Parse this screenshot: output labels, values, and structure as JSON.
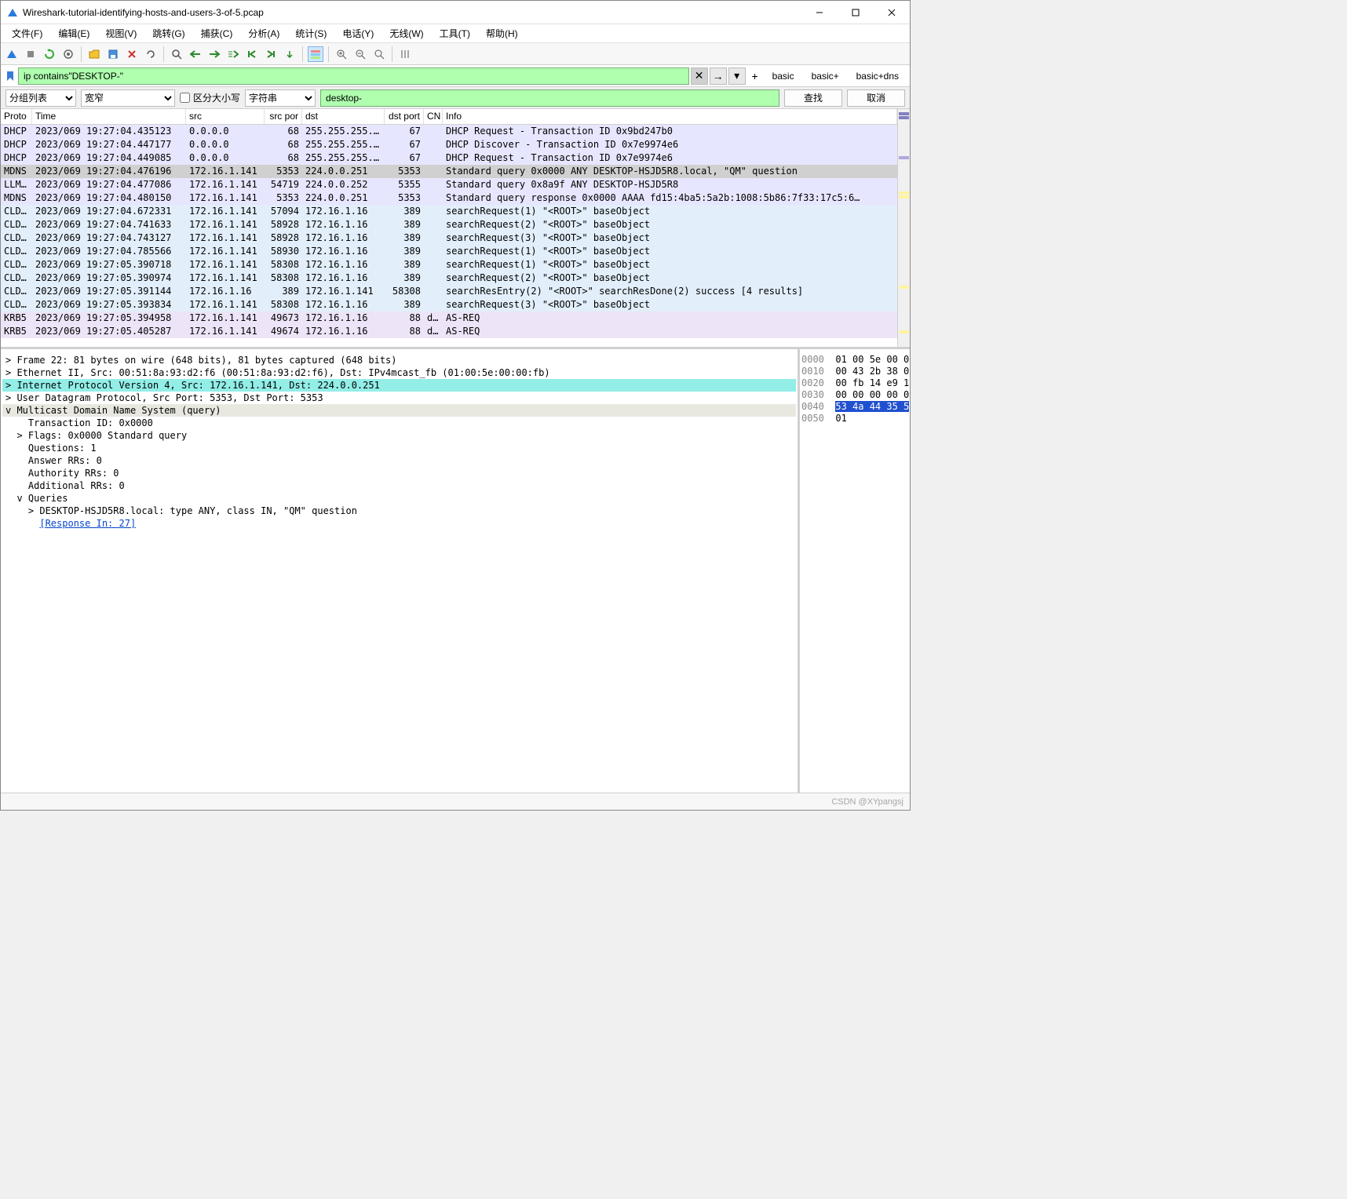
{
  "title": "Wireshark-tutorial-identifying-hosts-and-users-3-of-5.pcap",
  "menu": [
    "文件(F)",
    "编辑(E)",
    "视图(V)",
    "跳转(G)",
    "捕获(C)",
    "分析(A)",
    "统计(S)",
    "电话(Y)",
    "无线(W)",
    "工具(T)",
    "帮助(H)"
  ],
  "filter_presets": [
    "basic",
    "basic+",
    "basic+dns"
  ],
  "display_filter": "ip contains\"DESKTOP-\"",
  "search": {
    "list_mode": "分组列表",
    "width_mode": "宽窄",
    "case_label": "区分大小写",
    "type": "字符串",
    "value": "desktop-",
    "find": "查找",
    "cancel": "取消"
  },
  "columns": [
    "Proto",
    "Time",
    "src",
    "src por",
    "dst",
    "dst port",
    "CN",
    "Info"
  ],
  "rows": [
    {
      "cls": "bg-dhcp",
      "p": "DHCP",
      "t": "2023/069 19:27:04.435123",
      "s": "0.0.0.0",
      "sp": "68",
      "d": "255.255.255.…",
      "dp": "67",
      "cn": "",
      "i": "DHCP Request  - Transaction ID 0x9bd247b0"
    },
    {
      "cls": "bg-dhcp",
      "p": "DHCP",
      "t": "2023/069 19:27:04.447177",
      "s": "0.0.0.0",
      "sp": "68",
      "d": "255.255.255.…",
      "dp": "67",
      "cn": "",
      "i": "DHCP Discover - Transaction ID 0x7e9974e6"
    },
    {
      "cls": "bg-dhcp",
      "p": "DHCP",
      "t": "2023/069 19:27:04.449085",
      "s": "0.0.0.0",
      "sp": "68",
      "d": "255.255.255.…",
      "dp": "67",
      "cn": "",
      "i": "DHCP Request  - Transaction ID 0x7e9974e6"
    },
    {
      "cls": "bg-mdns-sel",
      "p": "MDNS",
      "t": "2023/069 19:27:04.476196",
      "s": "172.16.1.141",
      "sp": "5353",
      "d": "224.0.0.251",
      "dp": "5353",
      "cn": "",
      "i": "Standard query 0x0000 ANY DESKTOP-HSJD5R8.local, \"QM\" question"
    },
    {
      "cls": "bg-llm",
      "p": "LLM…",
      "t": "2023/069 19:27:04.477086",
      "s": "172.16.1.141",
      "sp": "54719",
      "d": "224.0.0.252",
      "dp": "5355",
      "cn": "",
      "i": "Standard query 0x8a9f ANY DESKTOP-HSJD5R8"
    },
    {
      "cls": "bg-mdns",
      "p": "MDNS",
      "t": "2023/069 19:27:04.480150",
      "s": "172.16.1.141",
      "sp": "5353",
      "d": "224.0.0.251",
      "dp": "5353",
      "cn": "",
      "i": "Standard query response 0x0000 AAAA fd15:4ba5:5a2b:1008:5b86:7f33:17c5:6…"
    },
    {
      "cls": "bg-cld",
      "p": "CLD…",
      "t": "2023/069 19:27:04.672331",
      "s": "172.16.1.141",
      "sp": "57094",
      "d": "172.16.1.16",
      "dp": "389",
      "cn": "",
      "i": "searchRequest(1) \"<ROOT>\" baseObject"
    },
    {
      "cls": "bg-cld",
      "p": "CLD…",
      "t": "2023/069 19:27:04.741633",
      "s": "172.16.1.141",
      "sp": "58928",
      "d": "172.16.1.16",
      "dp": "389",
      "cn": "",
      "i": "searchRequest(2) \"<ROOT>\" baseObject"
    },
    {
      "cls": "bg-cld",
      "p": "CLD…",
      "t": "2023/069 19:27:04.743127",
      "s": "172.16.1.141",
      "sp": "58928",
      "d": "172.16.1.16",
      "dp": "389",
      "cn": "",
      "i": "searchRequest(3) \"<ROOT>\" baseObject"
    },
    {
      "cls": "bg-cld",
      "p": "CLD…",
      "t": "2023/069 19:27:04.785566",
      "s": "172.16.1.141",
      "sp": "58930",
      "d": "172.16.1.16",
      "dp": "389",
      "cn": "",
      "i": "searchRequest(1) \"<ROOT>\" baseObject"
    },
    {
      "cls": "bg-cld",
      "p": "CLD…",
      "t": "2023/069 19:27:05.390718",
      "s": "172.16.1.141",
      "sp": "58308",
      "d": "172.16.1.16",
      "dp": "389",
      "cn": "",
      "i": "searchRequest(1) \"<ROOT>\" baseObject"
    },
    {
      "cls": "bg-cld",
      "p": "CLD…",
      "t": "2023/069 19:27:05.390974",
      "s": "172.16.1.141",
      "sp": "58308",
      "d": "172.16.1.16",
      "dp": "389",
      "cn": "",
      "i": "searchRequest(2) \"<ROOT>\" baseObject"
    },
    {
      "cls": "bg-cld",
      "p": "CLD…",
      "t": "2023/069 19:27:05.391144",
      "s": "172.16.1.16",
      "sp": "389",
      "d": "172.16.1.141",
      "dp": "58308",
      "cn": "",
      "i": "searchResEntry(2) \"<ROOT>\" searchResDone(2) success  [4 results]"
    },
    {
      "cls": "bg-cld",
      "p": "CLD…",
      "t": "2023/069 19:27:05.393834",
      "s": "172.16.1.141",
      "sp": "58308",
      "d": "172.16.1.16",
      "dp": "389",
      "cn": "",
      "i": "searchRequest(3) \"<ROOT>\" baseObject"
    },
    {
      "cls": "bg-krb",
      "p": "KRB5",
      "t": "2023/069 19:27:05.394958",
      "s": "172.16.1.141",
      "sp": "49673",
      "d": "172.16.1.16",
      "dp": "88",
      "cn": "d…",
      "i": "AS-REQ"
    },
    {
      "cls": "bg-krb",
      "p": "KRB5",
      "t": "2023/069 19:27:05.405287",
      "s": "172.16.1.141",
      "sp": "49674",
      "d": "172.16.1.16",
      "dp": "88",
      "cn": "d…",
      "i": "AS-REQ"
    }
  ],
  "details": [
    {
      "ind": 0,
      "exp": ">",
      "txt": "Frame 22: 81 bytes on wire (648 bits), 81 bytes captured (648 bits)"
    },
    {
      "ind": 0,
      "exp": ">",
      "txt": "Ethernet II, Src: 00:51:8a:93:d2:f6 (00:51:8a:93:d2:f6), Dst: IPv4mcast_fb (01:00:5e:00:00:fb)"
    },
    {
      "ind": 0,
      "exp": ">",
      "txt": "Internet Protocol Version 4, Src: 172.16.1.141, Dst: 224.0.0.251",
      "hl": true
    },
    {
      "ind": 0,
      "exp": ">",
      "txt": "User Datagram Protocol, Src Port: 5353, Dst Port: 5353"
    },
    {
      "ind": 0,
      "exp": "v",
      "txt": "Multicast Domain Name System (query)",
      "hl2": true
    },
    {
      "ind": 1,
      "exp": " ",
      "txt": "Transaction ID: 0x0000"
    },
    {
      "ind": 1,
      "exp": ">",
      "txt": "Flags: 0x0000 Standard query"
    },
    {
      "ind": 1,
      "exp": " ",
      "txt": "Questions: 1"
    },
    {
      "ind": 1,
      "exp": " ",
      "txt": "Answer RRs: 0"
    },
    {
      "ind": 1,
      "exp": " ",
      "txt": "Authority RRs: 0"
    },
    {
      "ind": 1,
      "exp": " ",
      "txt": "Additional RRs: 0"
    },
    {
      "ind": 1,
      "exp": "v",
      "txt": "Queries"
    },
    {
      "ind": 2,
      "exp": ">",
      "txt": "DESKTOP-HSJD5R8.local: type ANY, class IN, \"QM\" question"
    },
    {
      "ind": 2,
      "exp": " ",
      "txt": "[Response In: 27]",
      "link": true
    }
  ],
  "hex": [
    {
      "off": "0000",
      "b": "01 00 5e 00 0"
    },
    {
      "off": "0010",
      "b": "00 43 2b 38 0"
    },
    {
      "off": "0020",
      "b": "00 fb 14 e9 1"
    },
    {
      "off": "0030",
      "b": "00 00 00 00 0"
    },
    {
      "off": "0040",
      "b": "53 4a 44 35 5",
      "sel": true
    },
    {
      "off": "0050",
      "b": "01"
    }
  ],
  "watermark": "CSDN @XYpangsj"
}
